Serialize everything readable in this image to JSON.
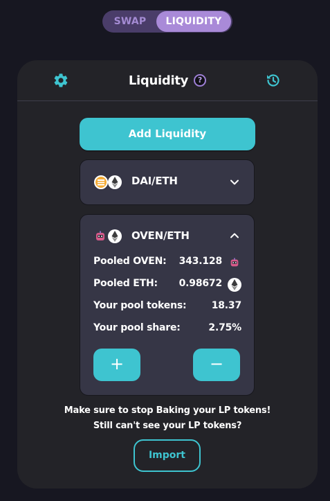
{
  "tabs": {
    "swap_label": "SWAP",
    "liquidity_label": "LIQUIDITY",
    "active": "LIQUIDITY"
  },
  "header": {
    "title": "Liquidity",
    "help_glyph": "?",
    "left_icon": "gear-icon",
    "right_icon": "history-icon"
  },
  "add_liquidity_label": "Add Liquidity",
  "pools": [
    {
      "name": "DAI/ETH",
      "tokens": [
        "dai-icon",
        "eth-icon"
      ],
      "expanded": false
    },
    {
      "name": "OVEN/ETH",
      "tokens": [
        "oven-icon",
        "eth-icon"
      ],
      "expanded": true,
      "rows": {
        "pooled_oven": {
          "label": "Pooled OVEN:",
          "value": "343.128"
        },
        "pooled_eth": {
          "label": "Pooled ETH:",
          "value": "0.98672"
        },
        "pool_tokens": {
          "label": "Your pool tokens:",
          "value": "18.37"
        },
        "pool_share": {
          "label": "Your pool share:",
          "value": "2.75%"
        }
      },
      "add_glyph": "+",
      "remove_glyph": "−"
    }
  ],
  "notes": {
    "line1": "Make sure to stop Baking your LP tokens!",
    "line2": "Still can't see your LP tokens?"
  },
  "import_label": "Import",
  "colors": {
    "background": "#171721",
    "card": "#232328",
    "pool_card": "#363646",
    "accent_teal": "#3ec4d0",
    "accent_purple": "#a98ad8",
    "tab_track": "#4a3d69"
  }
}
